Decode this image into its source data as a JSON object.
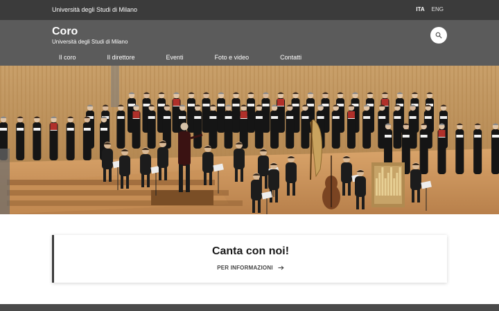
{
  "topbar": {
    "university": "Università degli Studi di Milano",
    "languages": [
      "ITA",
      "ENG"
    ]
  },
  "header": {
    "title": "Coro",
    "subtitle": "Università degli Studi di Milano",
    "search_icon": "search-icon"
  },
  "nav": {
    "items": [
      "Il coro",
      "Il direttore",
      "Eventi",
      "Foto e video",
      "Contatti"
    ]
  },
  "hero": {
    "image": "choir-concert-photo"
  },
  "cta": {
    "title": "Canta con noi!",
    "link_label": "PER INFORMAZIONI",
    "link_icon": "arrow-right-icon"
  },
  "colors": {
    "topbar_bg": "#3b3b3b",
    "header_bg": "#5b5b5b",
    "footer_bg": "#4a4a4a"
  }
}
